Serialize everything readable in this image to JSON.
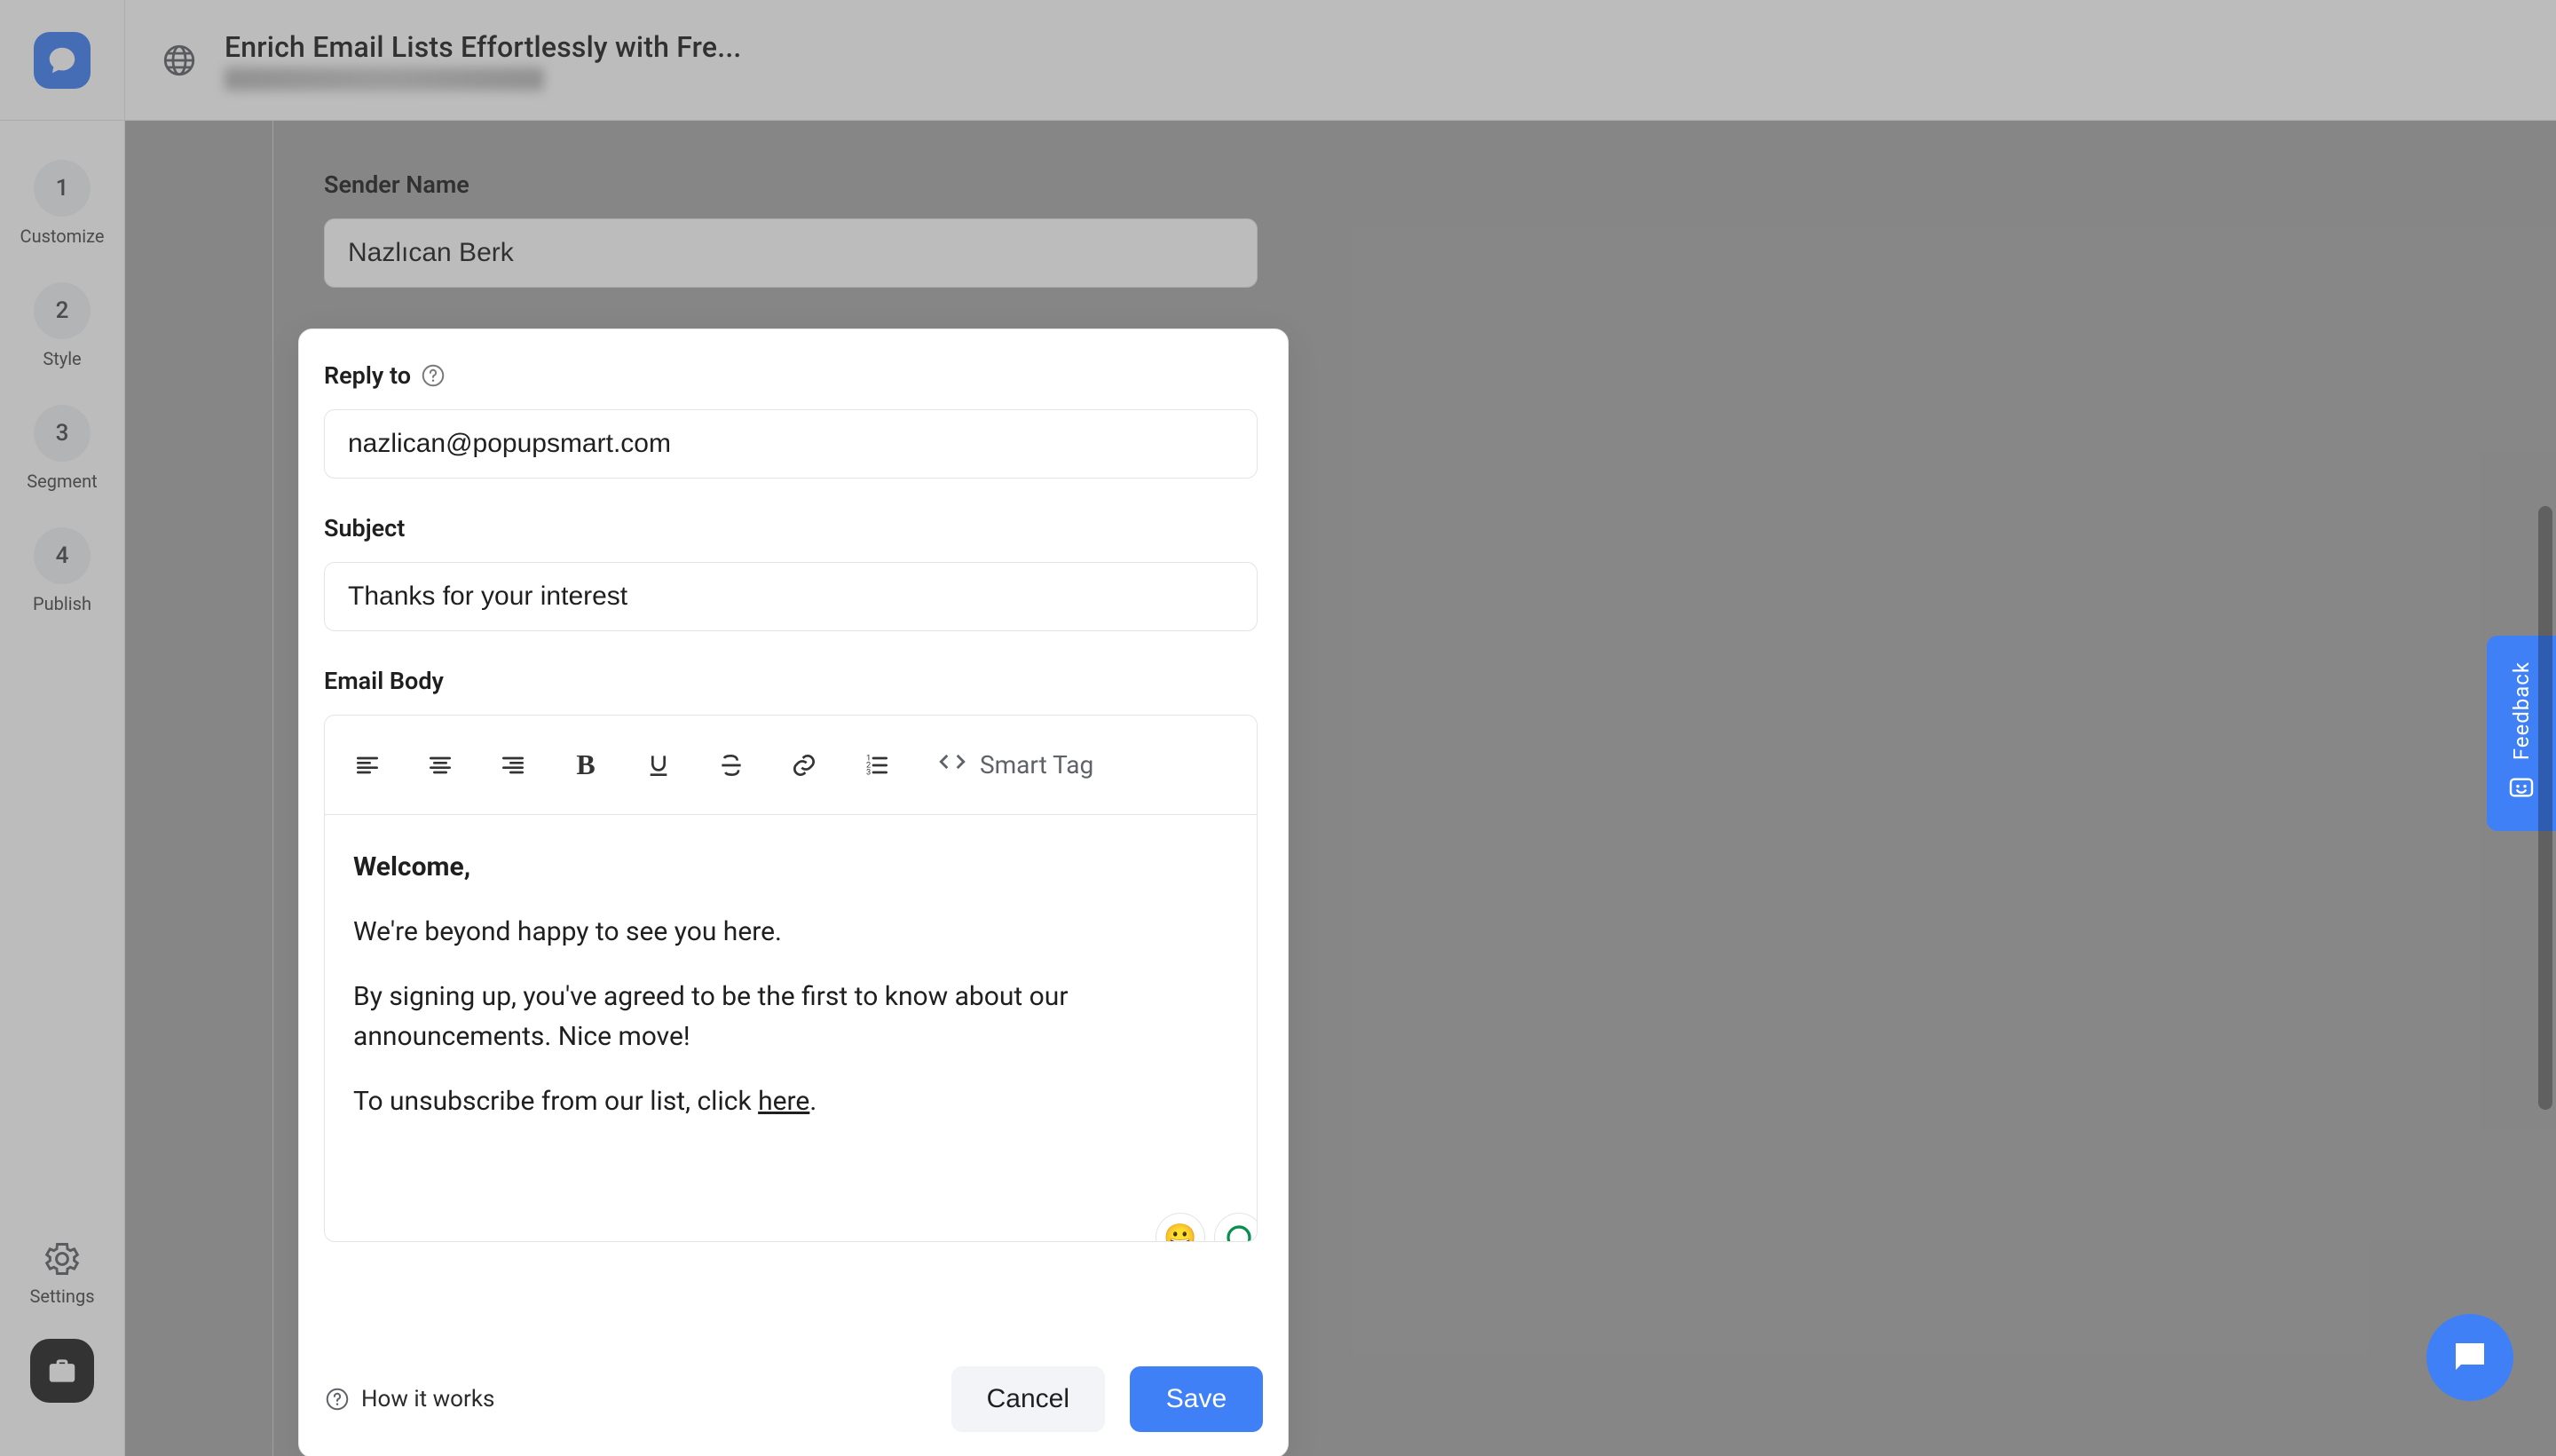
{
  "header": {
    "title": "Enrich Email Lists Effortlessly with Fre..."
  },
  "rail": {
    "steps": [
      {
        "num": "1",
        "label": "Customize"
      },
      {
        "num": "2",
        "label": "Style"
      },
      {
        "num": "3",
        "label": "Segment"
      },
      {
        "num": "4",
        "label": "Publish"
      }
    ],
    "settings_label": "Settings"
  },
  "form": {
    "sender_name_label": "Sender Name",
    "sender_name_value": "Nazlıcan Berk",
    "reply_to_label": "Reply to",
    "reply_to_value": "nazlican@popupsmart.com",
    "subject_label": "Subject",
    "subject_value": "Thanks for your interest",
    "email_body_label": "Email Body"
  },
  "editor": {
    "smart_tag_label": "Smart Tag",
    "welcome": "Welcome,",
    "p1": "We're beyond happy to see you here.",
    "p2": "By signing up, you've agreed to be the first to know about our announcements. Nice move!",
    "p3_a": "To unsubscribe from our list, click ",
    "p3_link": "here",
    "p3_b": "."
  },
  "footer": {
    "how_it_works": "How it works",
    "cancel": "Cancel",
    "save": "Save"
  },
  "feedback": {
    "label": "Feedback"
  }
}
